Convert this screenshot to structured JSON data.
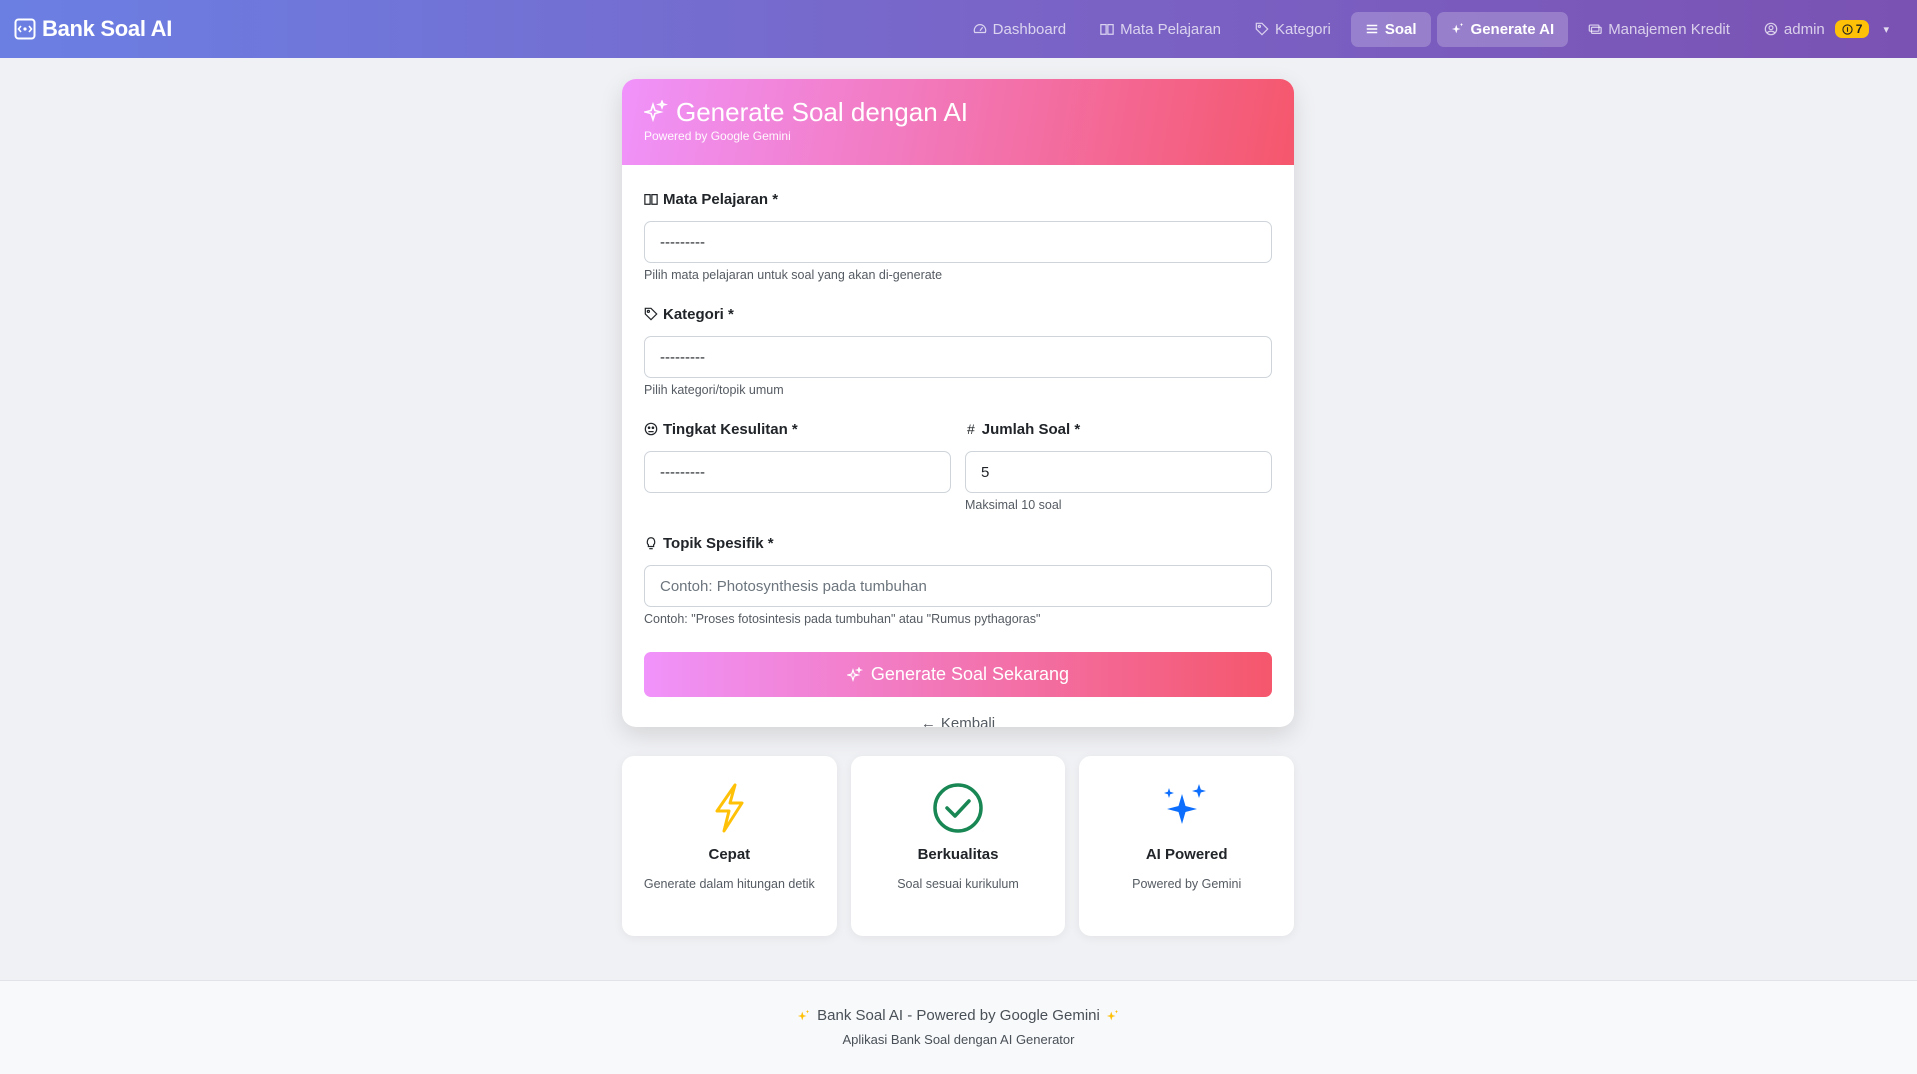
{
  "navbar": {
    "brand": "Bank Soal AI",
    "items": [
      {
        "label": "Dashboard",
        "icon": "speedometer-icon"
      },
      {
        "label": "Mata Pelajaran",
        "icon": "book-icon"
      },
      {
        "label": "Kategori",
        "icon": "tags-icon"
      },
      {
        "label": "Soal",
        "icon": "list-icon"
      },
      {
        "label": "Generate AI",
        "icon": "stars-icon"
      },
      {
        "label": "Manajemen Kredit",
        "icon": "cash-icon"
      }
    ],
    "user": {
      "name": "admin",
      "credits": "7"
    }
  },
  "form": {
    "title": "Generate Soal dengan AI",
    "subtitle": "Powered by Google Gemini",
    "subject": {
      "label": "Mata Pelajaran *",
      "value": "---------",
      "help": "Pilih mata pelajaran untuk soal yang akan di-generate"
    },
    "category": {
      "label": "Kategori *",
      "value": "---------",
      "help": "Pilih kategori/topik umum"
    },
    "difficulty": {
      "label": "Tingkat Kesulitan *",
      "value": "---------"
    },
    "count": {
      "label": "Jumlah Soal *",
      "value": "5",
      "help": "Maksimal 10 soal"
    },
    "topic": {
      "label": "Topik Spesifik *",
      "placeholder": "Contoh: Photosynthesis pada tumbuhan",
      "help": "Contoh: \"Proses fotosintesis pada tumbuhan\" atau \"Rumus pythagoras\""
    },
    "submit_label": "Generate Soal Sekarang",
    "back_label": "Kembali"
  },
  "features": [
    {
      "title": "Cepat",
      "desc": "Generate dalam hitungan detik",
      "icon": "lightning-icon",
      "color": "#ffc107"
    },
    {
      "title": "Berkualitas",
      "desc": "Soal sesuai kurikulum",
      "icon": "check-circle-icon",
      "color": "#198754"
    },
    {
      "title": "AI Powered",
      "desc": "Powered by Gemini",
      "icon": "stars-icon",
      "color": "#0d6efd"
    }
  ],
  "footer": {
    "main": "Bank Soal AI - Powered by Google Gemini",
    "sub": "Aplikasi Bank Soal dengan AI Generator"
  },
  "colors": {
    "nav_start": "#6b7fe3",
    "nav_end": "#7a52b3",
    "accent_start": "#f093fb",
    "accent_end": "#f5576c",
    "badge": "#ffc107"
  }
}
